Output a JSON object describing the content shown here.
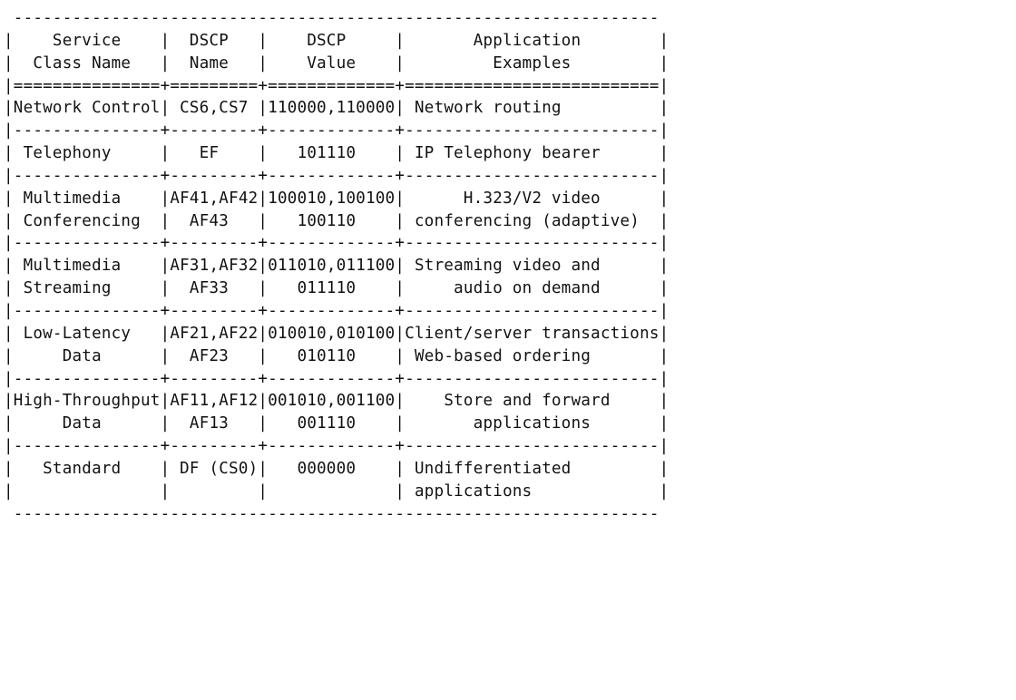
{
  "chart_data": {
    "type": "table",
    "title": "",
    "columns": [
      "Service Class Name",
      "DSCP Name",
      "DSCP Value",
      "Application Examples"
    ],
    "rows": [
      {
        "service_class": "Network Control",
        "dscp_name": "CS6,CS7",
        "dscp_value": "110000,110000",
        "application": "Network routing"
      },
      {
        "service_class": "Telephony",
        "dscp_name": "EF",
        "dscp_value": "101110",
        "application": "IP Telephony bearer"
      },
      {
        "service_class": "Multimedia Conferencing",
        "dscp_name": "AF41,AF42 AF43",
        "dscp_value": "100010,100100 100110",
        "application": "H.323/V2 video conferencing (adaptive)"
      },
      {
        "service_class": "Multimedia Streaming",
        "dscp_name": "AF31,AF32 AF33",
        "dscp_value": "011010,011100 011110",
        "application": "Streaming video and audio on demand"
      },
      {
        "service_class": "Low-Latency Data",
        "dscp_name": "AF21,AF22 AF23",
        "dscp_value": "010010,010100 010110",
        "application": "Client/server transactions Web-based ordering"
      },
      {
        "service_class": "High-Throughput Data",
        "dscp_name": "AF11,AF12 AF13",
        "dscp_value": "001010,001100 001110",
        "application": "Store and forward applications"
      },
      {
        "service_class": "Standard",
        "dscp_name": "DF (CS0)",
        "dscp_value": "000000",
        "application": "Undifferentiated applications"
      }
    ]
  },
  "table": {
    "widths": {
      "c1": 15,
      "c2": 9,
      "c3": 13,
      "c4": 26
    },
    "headers": {
      "c1a": "Service",
      "c1b": "Class Name",
      "c2a": "DSCP",
      "c2b": "Name",
      "c3a": "DSCP",
      "c3b": "Value",
      "c4a": "Application",
      "c4b": "Examples"
    },
    "rows": [
      {
        "lines": 1,
        "c1": [
          "Network Control"
        ],
        "c1a": [
          "left"
        ],
        "c2": [
          "CS6,CS7"
        ],
        "c2a": [
          "center"
        ],
        "c3": [
          "110000,110000"
        ],
        "c3a": [
          "left"
        ],
        "c4": [
          "Network routing"
        ],
        "c4a": [
          "left-pad"
        ]
      },
      {
        "lines": 1,
        "c1": [
          "Telephony"
        ],
        "c1a": [
          "left-pad"
        ],
        "c2": [
          "EF"
        ],
        "c2a": [
          "center"
        ],
        "c3": [
          "101110"
        ],
        "c3a": [
          "center"
        ],
        "c4": [
          "IP Telephony bearer"
        ],
        "c4a": [
          "left-pad"
        ]
      },
      {
        "lines": 2,
        "c1": [
          "Multimedia",
          "Conferencing"
        ],
        "c1a": [
          "left-pad",
          "left-pad"
        ],
        "c2": [
          "AF41,AF42",
          "AF43"
        ],
        "c2a": [
          "left",
          "center"
        ],
        "c3": [
          "100010,100100",
          "100110"
        ],
        "c3a": [
          "left",
          "center"
        ],
        "c4": [
          "H.323/V2 video",
          "conferencing (adaptive)"
        ],
        "c4a": [
          "center",
          "center"
        ]
      },
      {
        "lines": 2,
        "c1": [
          "Multimedia",
          "Streaming"
        ],
        "c1a": [
          "left-pad",
          "left-pad"
        ],
        "c2": [
          "AF31,AF32",
          "AF33"
        ],
        "c2a": [
          "left",
          "center"
        ],
        "c3": [
          "011010,011100",
          "011110"
        ],
        "c3a": [
          "left",
          "center"
        ],
        "c4": [
          "Streaming video and",
          "audio on demand"
        ],
        "c4a": [
          "left-pad",
          "center"
        ]
      },
      {
        "lines": 2,
        "c1": [
          "Low-Latency",
          "Data"
        ],
        "c1a": [
          "left-pad",
          "center"
        ],
        "c2": [
          "AF21,AF22",
          "AF23"
        ],
        "c2a": [
          "left",
          "center"
        ],
        "c3": [
          "010010,010100",
          "010110"
        ],
        "c3a": [
          "left",
          "center"
        ],
        "c4": [
          "Client/server transactions",
          "Web-based ordering"
        ],
        "c4a": [
          "left",
          "left-pad"
        ]
      },
      {
        "lines": 2,
        "c1": [
          "High-Throughput",
          "Data"
        ],
        "c1a": [
          "left",
          "center"
        ],
        "c2": [
          "AF11,AF12",
          "AF13"
        ],
        "c2a": [
          "left",
          "center"
        ],
        "c3": [
          "001010,001100",
          "001110"
        ],
        "c3a": [
          "left",
          "center"
        ],
        "c4": [
          "Store and forward",
          "applications"
        ],
        "c4a": [
          "center",
          "center"
        ]
      },
      {
        "lines": 2,
        "c1": [
          "Standard",
          ""
        ],
        "c1a": [
          "center",
          "left"
        ],
        "c2": [
          "DF (CS0)",
          ""
        ],
        "c2a": [
          "left-pad",
          "left"
        ],
        "c3": [
          "000000",
          ""
        ],
        "c3a": [
          "center",
          "left"
        ],
        "c4": [
          "Undifferentiated",
          "applications"
        ],
        "c4a": [
          "left-pad",
          "left-pad"
        ]
      }
    ]
  }
}
